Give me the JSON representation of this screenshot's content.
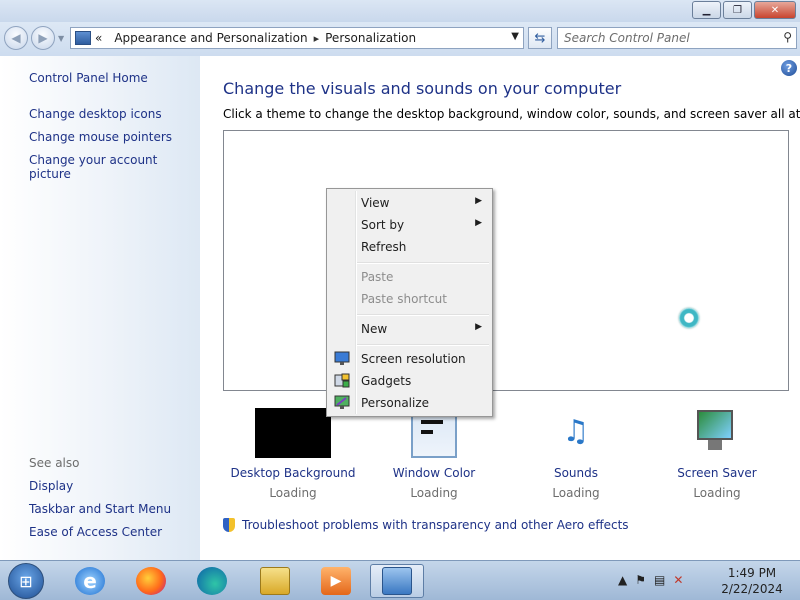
{
  "window": {
    "minimize_label": "▁",
    "maximize_label": "❐",
    "close_label": "✕"
  },
  "navbar": {
    "back_icon": "back-arrow-icon",
    "forward_icon": "forward-arrow-icon",
    "overflow_label": "«",
    "breadcrumb": [
      "Appearance and Personalization",
      "Personalization"
    ],
    "search_placeholder": "Search Control Panel"
  },
  "sidebar": {
    "home": "Control Panel Home",
    "links": [
      "Change desktop icons",
      "Change mouse pointers",
      "Change your account picture"
    ],
    "see_also_heading": "See also",
    "see_also": [
      "Display",
      "Taskbar and Start Menu",
      "Ease of Access Center"
    ]
  },
  "main": {
    "help_label": "?",
    "title": "Change the visuals and sounds on your computer",
    "subtitle": "Click a theme to change the desktop background, window color, sounds, and screen saver all at once.",
    "tiles": [
      {
        "label": "Desktop Background",
        "status": "Loading"
      },
      {
        "label": "Window Color",
        "status": "Loading"
      },
      {
        "label": "Sounds",
        "status": "Loading"
      },
      {
        "label": "Screen Saver",
        "status": "Loading"
      }
    ],
    "troubleshoot": "Troubleshoot problems with transparency and other Aero effects"
  },
  "context_menu": {
    "items": [
      {
        "label": "View",
        "submenu": true,
        "enabled": true
      },
      {
        "label": "Sort by",
        "submenu": true,
        "enabled": true
      },
      {
        "label": "Refresh",
        "submenu": false,
        "enabled": true
      },
      {
        "label": "Paste",
        "submenu": false,
        "enabled": false
      },
      {
        "label": "Paste shortcut",
        "submenu": false,
        "enabled": false
      },
      {
        "label": "New",
        "submenu": true,
        "enabled": true
      },
      {
        "label": "Screen resolution",
        "submenu": false,
        "enabled": true,
        "icon": "screen-resolution-icon"
      },
      {
        "label": "Gadgets",
        "submenu": false,
        "enabled": true,
        "icon": "gadgets-icon"
      },
      {
        "label": "Personalize",
        "submenu": false,
        "enabled": true,
        "icon": "personalize-icon"
      }
    ],
    "submenu_arrow": "▶"
  },
  "taskbar": {
    "apps": [
      "internet-explorer-icon",
      "firefox-icon",
      "edge-icon",
      "file-explorer-icon",
      "media-player-icon",
      "control-panel-icon"
    ],
    "clock_time": "1:49 PM",
    "clock_date": "2/22/2024",
    "tray_up": "▲",
    "tray_flag": "⚑"
  },
  "colors": {
    "link": "#1e3287",
    "window_bg": "#dfe8f3",
    "content_bg": "#ffffff"
  }
}
